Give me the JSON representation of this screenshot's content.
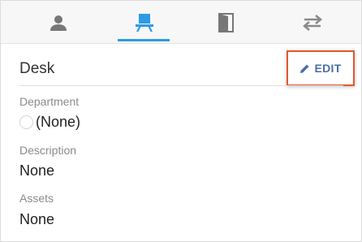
{
  "tabs": [
    {
      "icon": "person-icon",
      "active": false
    },
    {
      "icon": "desk-icon",
      "active": true
    },
    {
      "icon": "door-icon",
      "active": false
    },
    {
      "icon": "swap-arrows-icon",
      "active": false
    }
  ],
  "colors": {
    "active_tab": "#2e9ae6",
    "inactive_tab": "#777777",
    "edit_text": "#4a6fa5",
    "highlight_border": "#e8562a"
  },
  "header": {
    "title": "Desk",
    "edit_label": "EDIT"
  },
  "fields": {
    "department": {
      "label": "Department",
      "value": "(None)"
    },
    "description": {
      "label": "Description",
      "value": "None"
    },
    "assets": {
      "label": "Assets",
      "value": "None"
    }
  }
}
